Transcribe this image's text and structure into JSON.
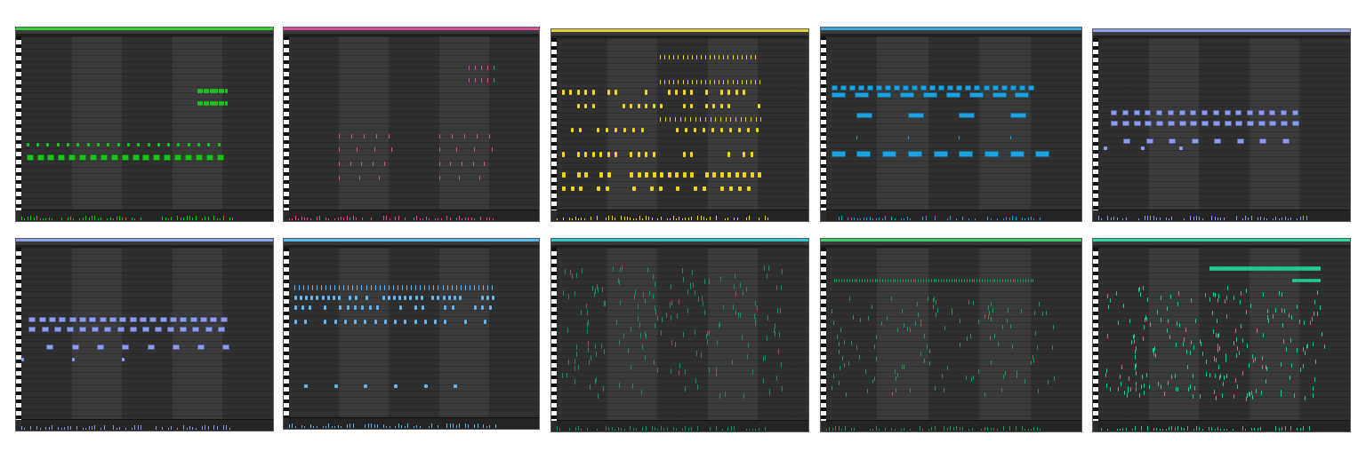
{
  "colors": {
    "panel_bg": "#2b2b2b",
    "bar_light": "#3b3b3b",
    "bar_dark": "#303030"
  },
  "clips": [
    {
      "id": "clip-1",
      "accent": "#3ccf3c",
      "note": "#19c419",
      "pattern": "sparse-two-rows-plus-top"
    },
    {
      "id": "clip-2",
      "accent": "#d94f9a",
      "note": "#d94f9a",
      "pattern": "thin-sparse"
    },
    {
      "id": "clip-3",
      "accent": "#e6d23a",
      "note": "#f2d51b",
      "pattern": "dense-yellow"
    },
    {
      "id": "clip-4",
      "accent": "#3aa3d9",
      "note": "#1ea1dc",
      "pattern": "blue-lines"
    },
    {
      "id": "clip-5",
      "accent": "#8ea4e6",
      "note": "#8a9cf0",
      "pattern": "periwinkle"
    },
    {
      "id": "clip-6",
      "accent": "#8ea4e6",
      "note": "#8a9cf0",
      "pattern": "periwinkle-b"
    },
    {
      "id": "clip-7",
      "accent": "#5ab8e8",
      "note": "#5fb6f0",
      "pattern": "light-blue-dense"
    },
    {
      "id": "clip-8",
      "accent": "#2ec6c6",
      "note": "#1e8a6a",
      "pattern": "teal-dense"
    },
    {
      "id": "clip-9",
      "accent": "#3ccf6a",
      "note": "#1f9a55",
      "pattern": "green-dense"
    },
    {
      "id": "clip-10",
      "accent": "#2ed6a0",
      "note": "#22c98e",
      "pattern": "mint-dense-top"
    }
  ]
}
